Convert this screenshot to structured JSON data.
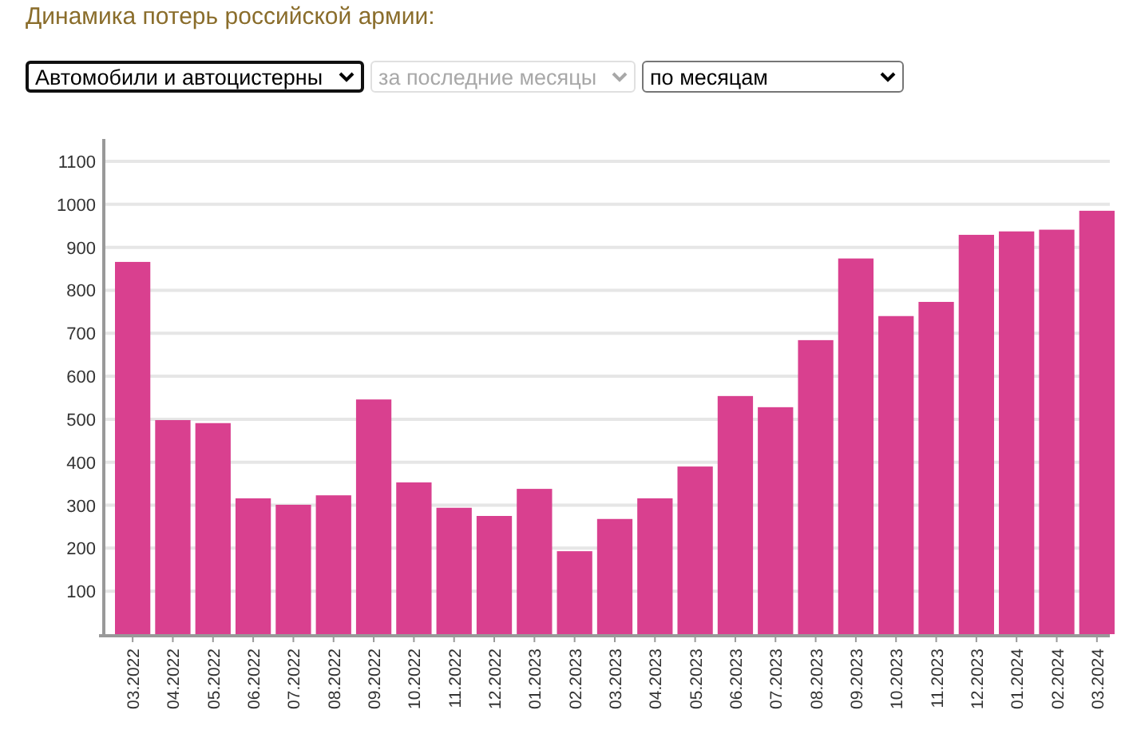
{
  "title": "Динамика потерь российской армии:",
  "selects": [
    {
      "value": "Автомобили и автоцистерны",
      "disabled": false,
      "focused": true
    },
    {
      "value": "за последние месяцы",
      "disabled": true,
      "focused": false
    },
    {
      "value": "по месяцам",
      "disabled": false,
      "focused": false
    }
  ],
  "chart_data": {
    "type": "bar",
    "categories": [
      "03.2022",
      "04.2022",
      "05.2022",
      "06.2022",
      "07.2022",
      "08.2022",
      "09.2022",
      "10.2022",
      "11.2022",
      "12.2022",
      "01.2023",
      "02.2023",
      "03.2023",
      "04.2023",
      "05.2023",
      "06.2023",
      "07.2023",
      "08.2023",
      "09.2023",
      "10.2023",
      "11.2023",
      "12.2023",
      "01.2024",
      "02.2024",
      "03.2024"
    ],
    "grid": true,
    "series": [
      {
        "color": "#d9408f",
        "values": [
          866,
          498,
          491,
          316,
          301,
          323,
          546,
          353,
          294,
          275,
          338,
          193,
          268,
          316,
          390,
          554,
          528,
          684,
          874,
          740,
          773,
          929,
          937,
          941,
          985
        ]
      }
    ],
    "ylim": [
      0,
      1100
    ],
    "yticks": [
      100,
      200,
      300,
      400,
      500,
      600,
      700,
      800,
      900,
      1000,
      1100
    ]
  }
}
